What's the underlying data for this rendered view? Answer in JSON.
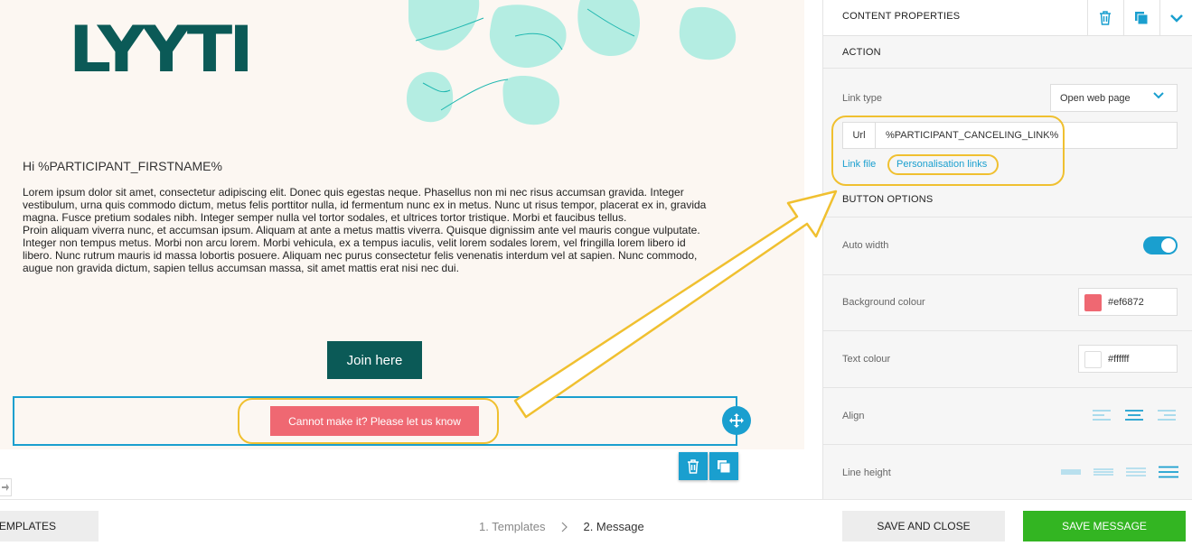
{
  "email": {
    "logo": "LYYTI",
    "greeting": "Hi %PARTICIPANT_FIRSTNAME%",
    "paragraph1": "Lorem ipsum dolor sit amet, consectetur adipiscing elit. Donec quis egestas neque. Phasellus non mi nec risus accumsan gravida. Integer vestibulum, urna quis commodo dictum, metus felis porttitor nulla, id fermentum nunc ex in metus. Nunc ut risus tempor, placerat ex in, gravida magna. Fusce pretium sodales nibh. Integer semper nulla vel tortor sodales, et ultrices tortor tristique. Morbi et faucibus tellus.",
    "paragraph2": "Proin aliquam viverra nunc, et accumsan ipsum. Aliquam at ante a metus mattis viverra. Quisque dignissim ante vel mauris congue vulputate. Integer non tempus metus. Morbi non arcu lorem. Morbi vehicula, ex a tempus iaculis, velit lorem sodales lorem, vel fringilla lorem libero id libero. Nunc rutrum mauris id massa lobortis posuere. Aliquam nec purus consectetur felis venenatis interdum vel at sapien. Nunc commodo, augue non gravida dictum, sapien tellus accumsan massa, sit amet mattis erat nisi nec dui.",
    "join_button": "Join here",
    "cancel_button": "Cannot make it? Please let us know"
  },
  "panel": {
    "title": "CONTENT PROPERTIES",
    "action_section": "ACTION",
    "link_type_label": "Link type",
    "link_type_value": "Open web page",
    "url_prefix": "Url",
    "url_value": "%PARTICIPANT_CANCELING_LINK%",
    "link_file": "Link file",
    "personalisation_links": "Personalisation links",
    "button_options_section": "BUTTON OPTIONS",
    "auto_width_label": "Auto width",
    "auto_width_on": true,
    "background_colour_label": "Background colour",
    "background_colour_value": "#ef6872",
    "text_colour_label": "Text colour",
    "text_colour_value": "#ffffff",
    "align_label": "Align",
    "line_height_label": "Line height"
  },
  "footer": {
    "templates_button": "TEMPLATES",
    "step1": "1. Templates",
    "step2": "2. Message",
    "save_close_button": "SAVE AND CLOSE",
    "save_message_button": "SAVE MESSAGE"
  },
  "colors": {
    "brand_dark_teal": "#0b5a57",
    "accent_blue": "#1a9fcf",
    "cancel_red": "#ef6872",
    "save_green": "#33b522",
    "highlight_yellow": "#f0c030"
  }
}
